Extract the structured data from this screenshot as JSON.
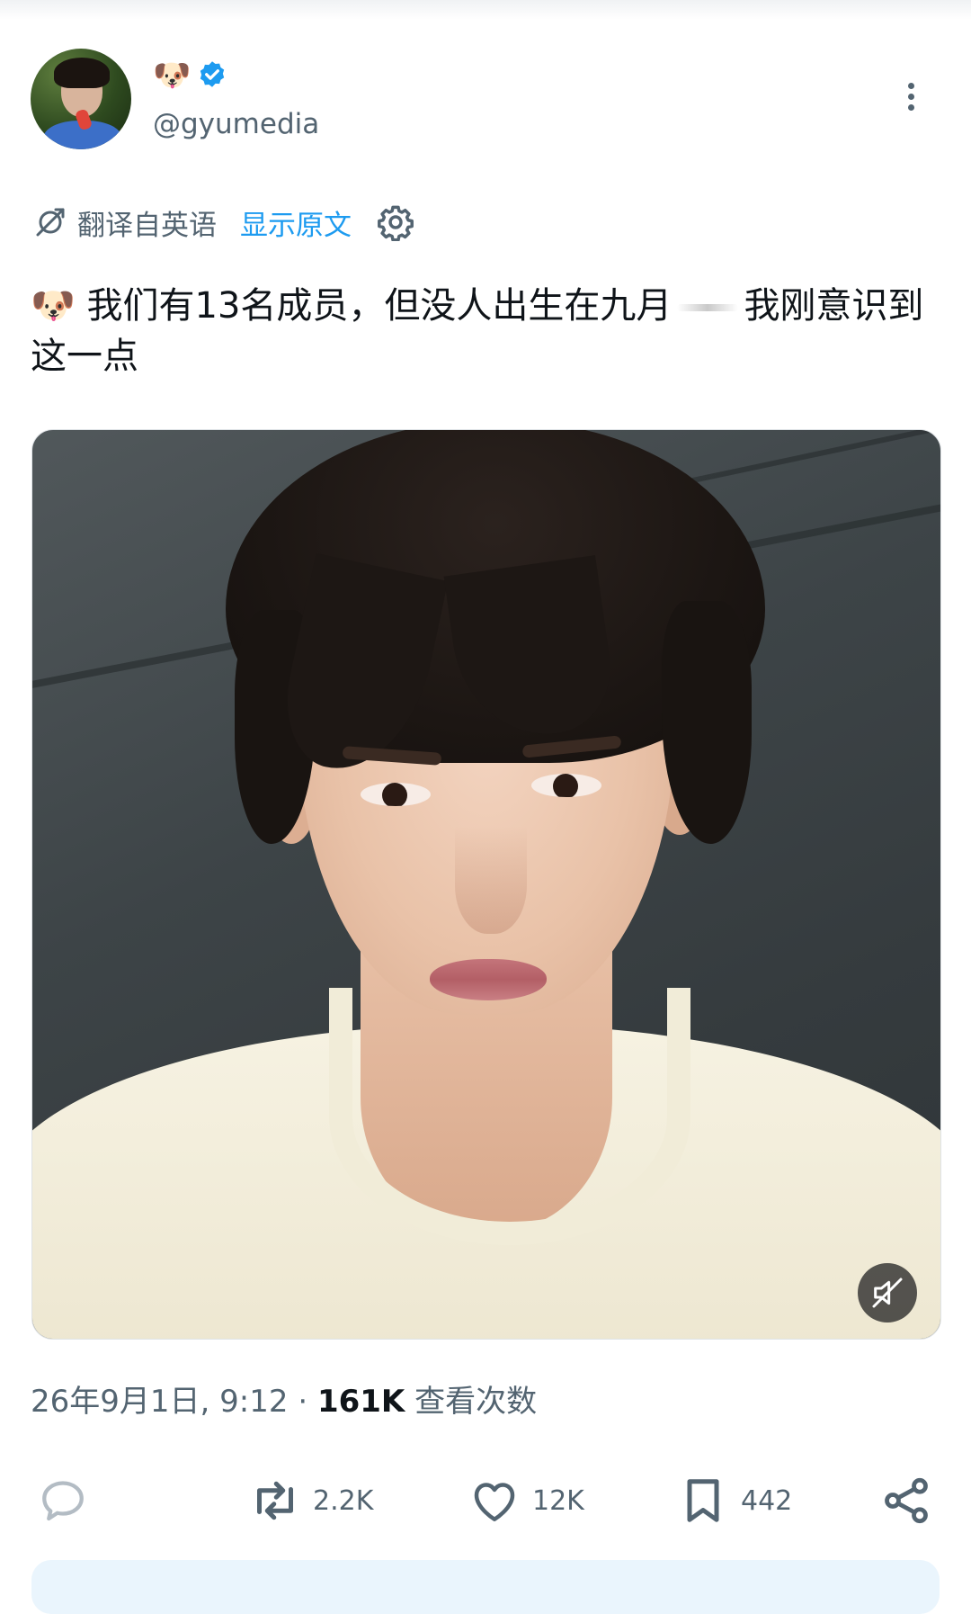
{
  "author": {
    "display_name_emoji": "🐶",
    "handle": "@gyumedia",
    "verified": true,
    "avatar_icon": "user-avatar"
  },
  "translation": {
    "label": "翻译自英语",
    "show_original": "显示原文",
    "settings_icon": "gear-icon"
  },
  "tweet": {
    "emoji": "🐶",
    "text_part1": "我们有13名成员，但没人出生在九月",
    "text_part2": "我刚意识到这一点"
  },
  "media": {
    "type": "video",
    "mute_icon": "muted-speaker-icon"
  },
  "meta": {
    "date": "26年9月1日, 9:12",
    "separator": "·",
    "views_count": "161K",
    "views_label": "查看次数"
  },
  "actions": {
    "reply_count": "",
    "retweet_count": "2.2K",
    "like_count": "12K",
    "bookmark_count": "442"
  },
  "colors": {
    "accent": "#1d9bf0",
    "secondary_text": "#536471",
    "primary_text": "#0f1419"
  }
}
